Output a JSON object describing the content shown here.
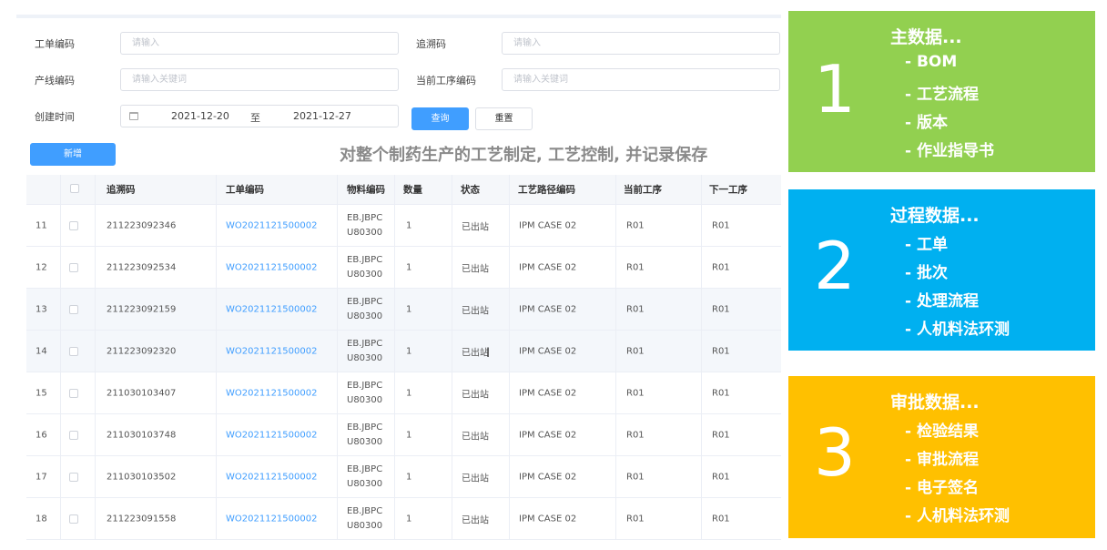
{
  "form": {
    "order_code_label": "工单编码",
    "order_code_placeholder": "请输入",
    "trace_code_label": "追溯码",
    "trace_code_placeholder": "请输入",
    "line_code_label": "产线编码",
    "line_code_placeholder": "请输入关键词",
    "process_code_label": "当前工序编码",
    "process_code_placeholder": "请输入关键词",
    "created_time_label": "创建时间",
    "date_start": "2021-12-20",
    "date_separator": "至",
    "date_end": "2021-12-27",
    "query_label": "查询",
    "reset_label": "重置"
  },
  "toolbar": {
    "add_label": "新增"
  },
  "caption": "对整个制药生产的工艺制定, 工艺控制, 并记录保存",
  "table": {
    "columns": [
      "追溯码",
      "工单编码",
      "物料编码",
      "数量",
      "状态",
      "工艺路径编码",
      "当前工序",
      "下一工序"
    ],
    "rows": [
      {
        "index": "11",
        "trace": "211223092346",
        "order": "WO2021121500002",
        "mat1": "EB.JBPC",
        "mat2": "U80300",
        "qty": "1",
        "status": "已出站",
        "route": "IPM CASE 02",
        "current": "R01",
        "next": "R01"
      },
      {
        "index": "12",
        "trace": "211223092534",
        "order": "WO2021121500002",
        "mat1": "EB.JBPC",
        "mat2": "U80300",
        "qty": "1",
        "status": "已出站",
        "route": "IPM CASE 02",
        "current": "R01",
        "next": "R01"
      },
      {
        "index": "13",
        "trace": "211223092159",
        "order": "WO2021121500002",
        "mat1": "EB.JBPC",
        "mat2": "U80300",
        "qty": "1",
        "status": "已出站",
        "route": "IPM CASE 02",
        "current": "R01",
        "next": "R01"
      },
      {
        "index": "14",
        "trace": "211223092320",
        "order": "WO2021121500002",
        "mat1": "EB.JBPC",
        "mat2": "U80300",
        "qty": "1",
        "status": "已出站",
        "route": "IPM CASE 02",
        "current": "R01",
        "next": "R01"
      },
      {
        "index": "15",
        "trace": "211030103407",
        "order": "WO2021121500002",
        "mat1": "EB.JBPC",
        "mat2": "U80300",
        "qty": "1",
        "status": "已出站",
        "route": "IPM CASE 02",
        "current": "R01",
        "next": "R01"
      },
      {
        "index": "16",
        "trace": "211030103748",
        "order": "WO2021121500002",
        "mat1": "EB.JBPC",
        "mat2": "U80300",
        "qty": "1",
        "status": "已出站",
        "route": "IPM CASE 02",
        "current": "R01",
        "next": "R01"
      },
      {
        "index": "17",
        "trace": "211030103502",
        "order": "WO2021121500002",
        "mat1": "EB.JBPC",
        "mat2": "U80300",
        "qty": "1",
        "status": "已出站",
        "route": "IPM CASE 02",
        "current": "R01",
        "next": "R01"
      },
      {
        "index": "18",
        "trace": "211223091558",
        "order": "WO2021121500002",
        "mat1": "EB.JBPC",
        "mat2": "U80300",
        "qty": "1",
        "status": "已出站",
        "route": "IPM CASE 02",
        "current": "R01",
        "next": "R01"
      }
    ]
  },
  "panels": [
    {
      "number": "1",
      "title": "主数据...",
      "items": [
        "- BOM",
        "- 工艺流程",
        "- 版本",
        "- 作业指导书"
      ],
      "color": "#92d050"
    },
    {
      "number": "2",
      "title": "过程数据...",
      "items": [
        "- 工单",
        "- 批次",
        "- 处理流程",
        "- 人机料法环测"
      ],
      "color": "#00b0f0"
    },
    {
      "number": "3",
      "title": "审批数据...",
      "items": [
        "- 检验结果",
        "- 审批流程",
        "- 电子签名",
        "- 人机料法环测"
      ],
      "color": "#ffc000"
    }
  ],
  "colors": {
    "primary": "#409eff",
    "link": "#409eff",
    "text_cursor_icon": "I-beam"
  }
}
